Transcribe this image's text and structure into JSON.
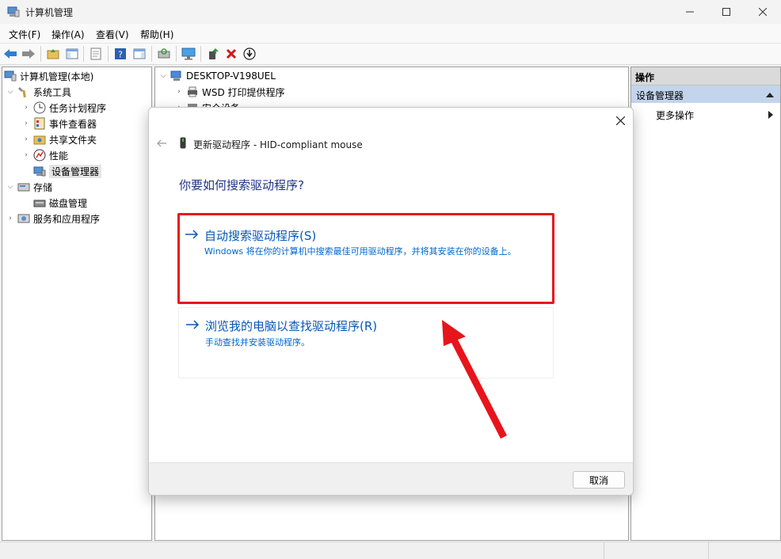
{
  "window": {
    "title": "计算机管理"
  },
  "menu": [
    "文件(F)",
    "操作(A)",
    "查看(V)",
    "帮助(H)"
  ],
  "tree": {
    "root": "计算机管理(本地)",
    "system_tools": "系统工具",
    "task_scheduler": "任务计划程序",
    "event_viewer": "事件查看器",
    "shared_folders": "共享文件夹",
    "performance": "性能",
    "device_manager": "设备管理器",
    "storage": "存储",
    "disk_management": "磁盘管理",
    "services_apps": "服务和应用程序"
  },
  "devices": {
    "computer": "DESKTOP-V198UEL",
    "wsd": "WSD 打印提供程序",
    "security": "安全设备"
  },
  "actions": {
    "header": "操作",
    "section": "设备管理器",
    "more": "更多操作"
  },
  "dialog": {
    "title": "更新驱动程序 - HID-compliant mouse",
    "question": "你要如何搜索驱动程序?",
    "opt1_title": "自动搜索驱动程序(S)",
    "opt1_desc": "Windows 将在你的计算机中搜索最佳可用驱动程序，并将其安装在你的设备上。",
    "opt2_title": "浏览我的电脑以查找驱动程序(R)",
    "opt2_desc": "手动查找并安装驱动程序。",
    "cancel": "取消"
  },
  "colors": {
    "accent": "#0658b5",
    "highlight": "#e8141c"
  }
}
